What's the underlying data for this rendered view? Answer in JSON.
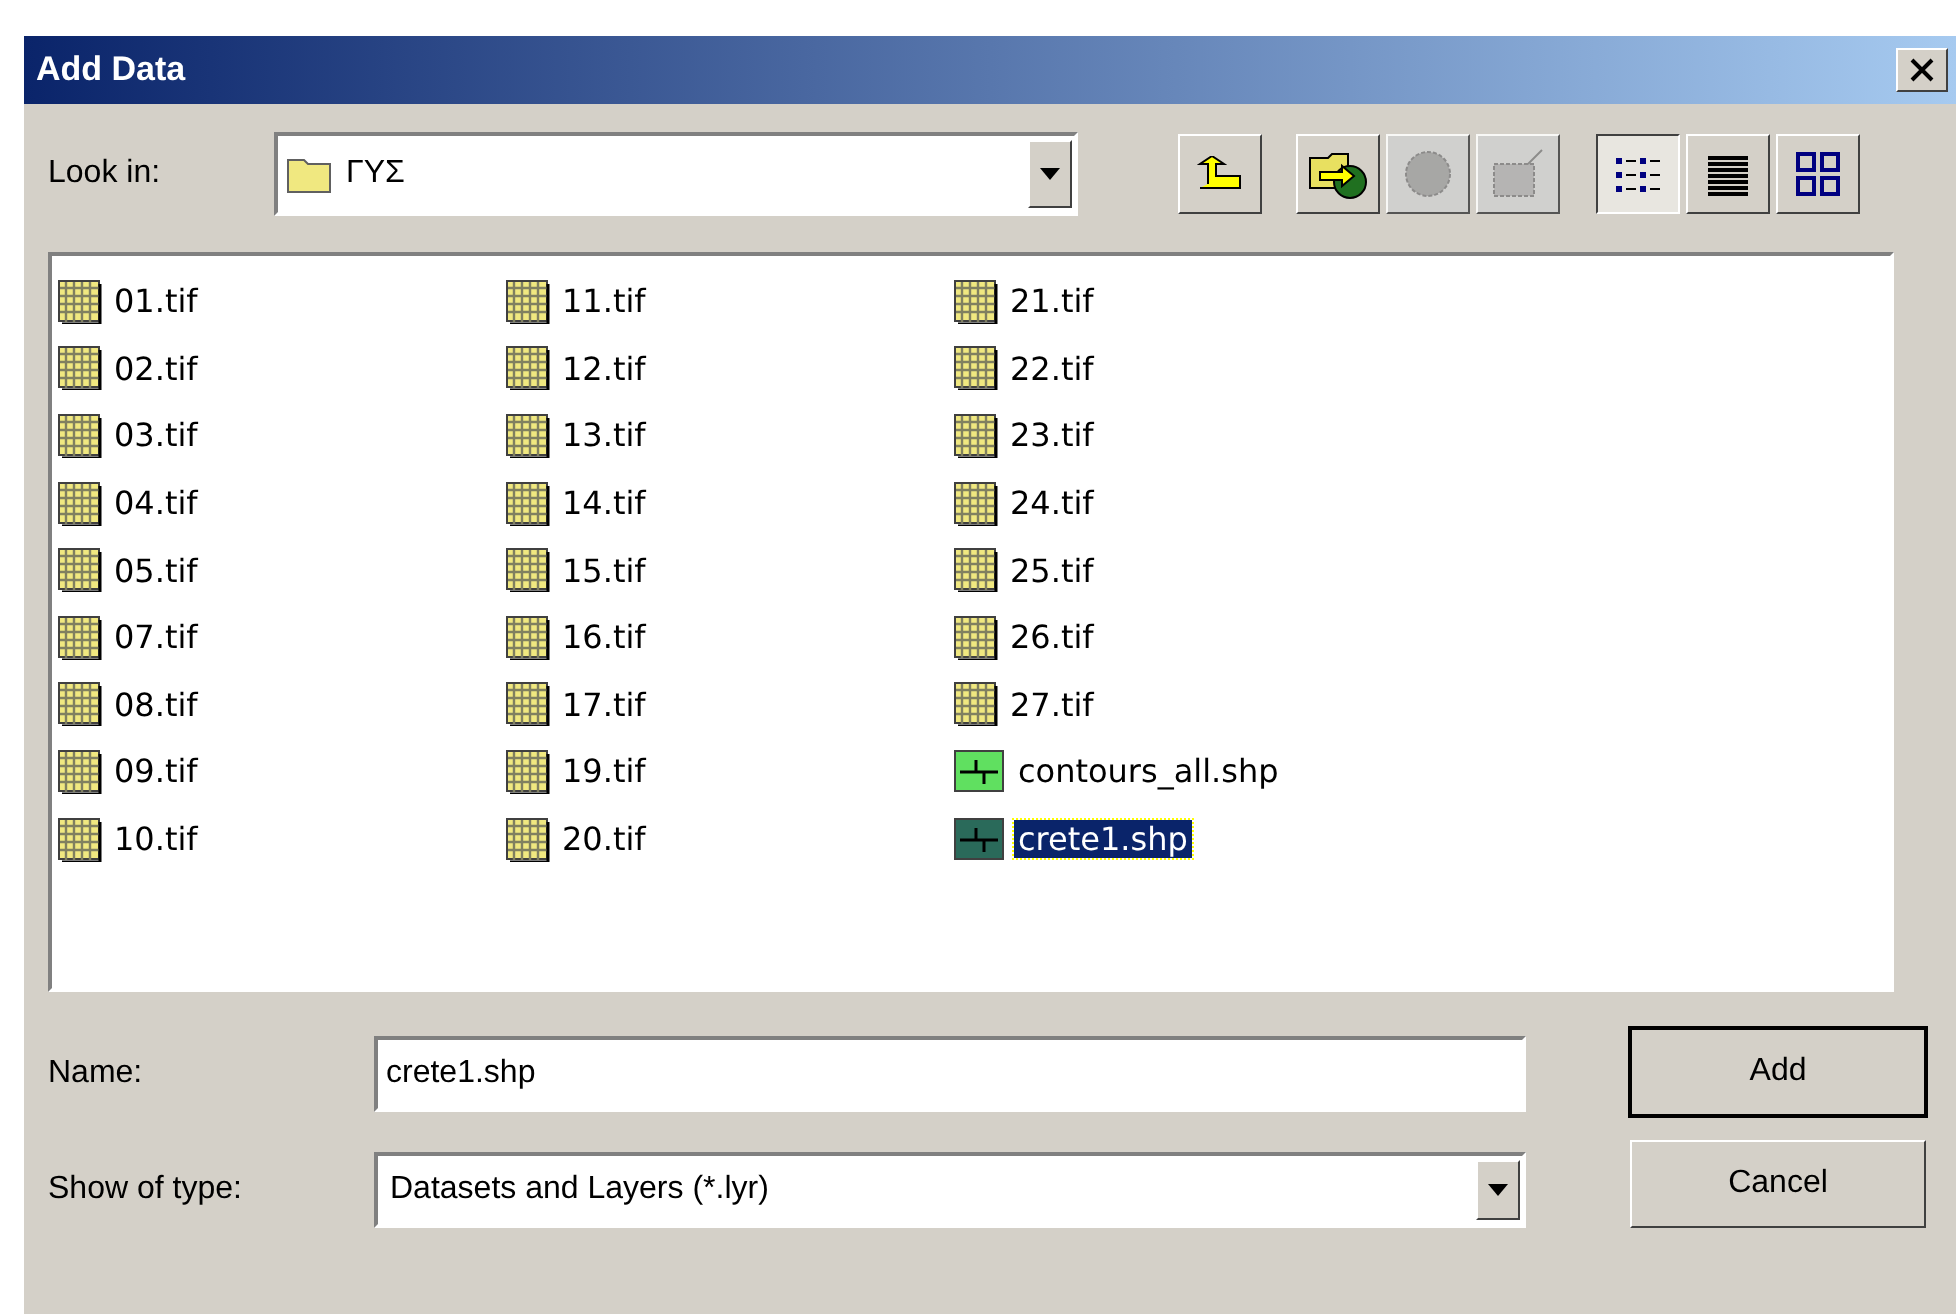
{
  "window": {
    "title": "Add Data"
  },
  "look_in": {
    "label": "Look in:",
    "value": "ΓΥΣ"
  },
  "toolbar": [
    {
      "kind": "up",
      "disabled": false
    },
    {
      "kind": "connect",
      "disabled": false
    },
    {
      "kind": "globe",
      "disabled": true
    },
    {
      "kind": "database",
      "disabled": true
    }
  ],
  "views": [
    {
      "kind": "list",
      "selected": true
    },
    {
      "kind": "details",
      "selected": false
    },
    {
      "kind": "thumbnails",
      "selected": false
    }
  ],
  "files": [
    {
      "name": "01.tif",
      "kind": "raster",
      "selected": false
    },
    {
      "name": "02.tif",
      "kind": "raster",
      "selected": false
    },
    {
      "name": "03.tif",
      "kind": "raster",
      "selected": false
    },
    {
      "name": "04.tif",
      "kind": "raster",
      "selected": false
    },
    {
      "name": "05.tif",
      "kind": "raster",
      "selected": false
    },
    {
      "name": "07.tif",
      "kind": "raster",
      "selected": false
    },
    {
      "name": "08.tif",
      "kind": "raster",
      "selected": false
    },
    {
      "name": "09.tif",
      "kind": "raster",
      "selected": false
    },
    {
      "name": "10.tif",
      "kind": "raster",
      "selected": false
    },
    {
      "name": "11.tif",
      "kind": "raster",
      "selected": false
    },
    {
      "name": "12.tif",
      "kind": "raster",
      "selected": false
    },
    {
      "name": "13.tif",
      "kind": "raster",
      "selected": false
    },
    {
      "name": "14.tif",
      "kind": "raster",
      "selected": false
    },
    {
      "name": "15.tif",
      "kind": "raster",
      "selected": false
    },
    {
      "name": "16.tif",
      "kind": "raster",
      "selected": false
    },
    {
      "name": "17.tif",
      "kind": "raster",
      "selected": false
    },
    {
      "name": "19.tif",
      "kind": "raster",
      "selected": false
    },
    {
      "name": "20.tif",
      "kind": "raster",
      "selected": false
    },
    {
      "name": "21.tif",
      "kind": "raster",
      "selected": false
    },
    {
      "name": "22.tif",
      "kind": "raster",
      "selected": false
    },
    {
      "name": "23.tif",
      "kind": "raster",
      "selected": false
    },
    {
      "name": "24.tif",
      "kind": "raster",
      "selected": false
    },
    {
      "name": "25.tif",
      "kind": "raster",
      "selected": false
    },
    {
      "name": "26.tif",
      "kind": "raster",
      "selected": false
    },
    {
      "name": "27.tif",
      "kind": "raster",
      "selected": false
    },
    {
      "name": "contours_all.shp",
      "kind": "shapefile",
      "selected": false
    },
    {
      "name": "crete1.shp",
      "kind": "shapefile",
      "selected": true
    }
  ],
  "name_field": {
    "label": "Name:",
    "value": "crete1.shp"
  },
  "type_field": {
    "label": "Show of type:",
    "value": "Datasets and Layers (*.lyr)"
  },
  "buttons": [
    {
      "label": "Add",
      "default": true
    },
    {
      "label": "Cancel",
      "default": false
    }
  ]
}
